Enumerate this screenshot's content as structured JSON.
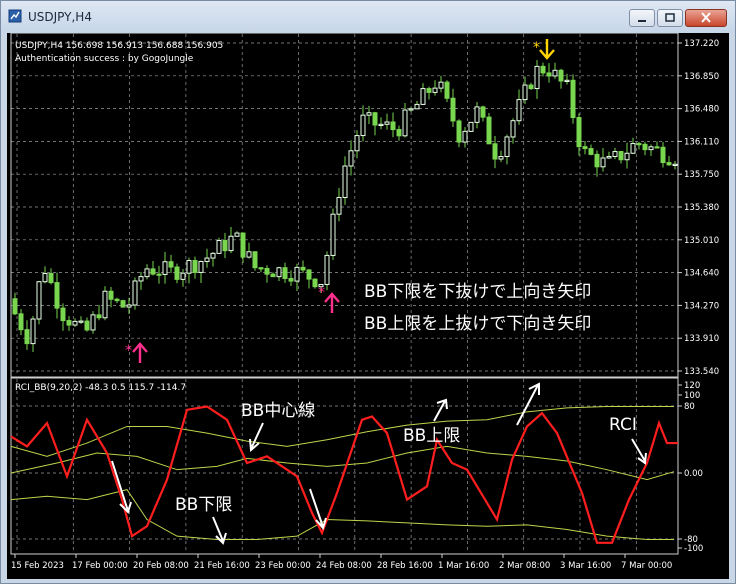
{
  "window": {
    "title": "USDJPY,H4"
  },
  "main_chart": {
    "header_line": "USDJPY,H4  156.698 156.913 156.688 156.905",
    "auth_line": "Authentication success : by GogoJungle",
    "price_labels": [
      "137.220",
      "136.850",
      "136.480",
      "136.110",
      "135.750",
      "135.380",
      "135.010",
      "134.640",
      "134.270",
      "133.910",
      "133.540"
    ],
    "annotation_line1": "BB下限を下抜けで上向き矢印",
    "annotation_line2": "BB上限を上抜けで下向き矢印"
  },
  "indicator": {
    "header_line": "RCI_BB(9,20,2) -48.3 0.5 115.7 -114.7",
    "scale_labels": [
      "120",
      "100",
      "80",
      "0.00",
      "-80",
      "-100"
    ],
    "label_mid": "BB中心線",
    "label_upper": "BB上限",
    "label_lower": "BB下限",
    "label_rci": "RCI"
  },
  "time_axis": {
    "labels": [
      "15 Feb 2023",
      "17 Feb 00:00",
      "20 Feb 08:00",
      "21 Feb 16:00",
      "23 Feb 00:00",
      "24 Feb 08:00",
      "28 Feb 16:00",
      "1 Mar 16:00",
      "2 Mar 08:00",
      "3 Mar 16:00",
      "7 Mar 00:00"
    ]
  },
  "colors": {
    "bull": "#e8ffe8",
    "bear": "#79d64f",
    "rci": "#ff1e1e",
    "bands": "#bcd64a",
    "buy_arrow": "#ff2f8e",
    "sell_arrow": "#ffd400",
    "annotation_text": "#ffffff",
    "grid": "#9a9a9a"
  },
  "chart_data": {
    "type": "candlestick",
    "symbol": "USDJPY",
    "timeframe": "H4",
    "ylim": [
      133.54,
      137.22
    ],
    "rci_ylim": [
      -100,
      100
    ]
  }
}
